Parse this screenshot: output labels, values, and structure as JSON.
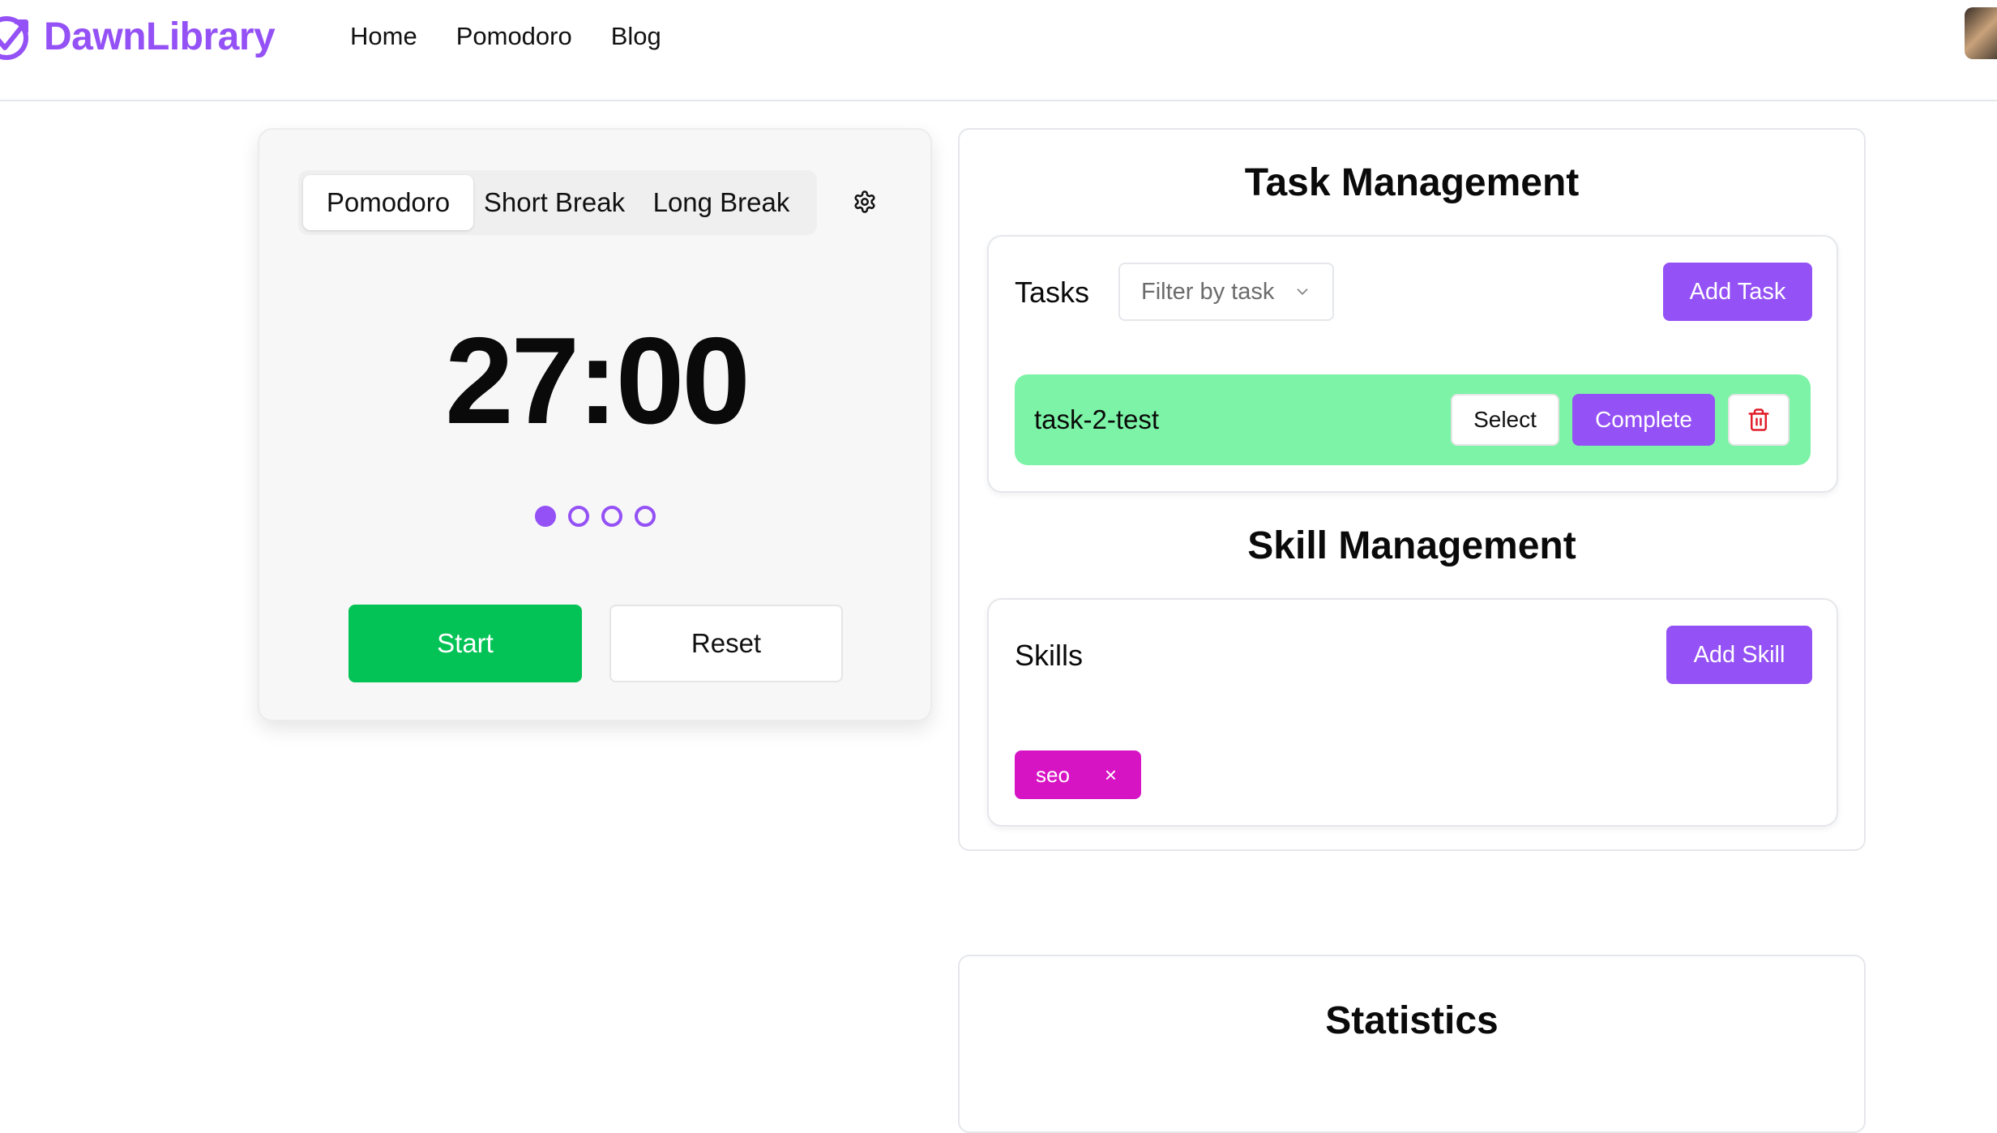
{
  "header": {
    "brand": "DawnLibrary",
    "nav": [
      {
        "label": "Home"
      },
      {
        "label": "Pomodoro"
      },
      {
        "label": "Blog"
      }
    ]
  },
  "timer": {
    "tabs": [
      {
        "label": "Pomodoro",
        "active": true
      },
      {
        "label": "Short Break",
        "active": false
      },
      {
        "label": "Long Break",
        "active": false
      }
    ],
    "time": "27:00",
    "sessions_completed": 1,
    "sessions_total": 4,
    "start_label": "Start",
    "reset_label": "Reset"
  },
  "task_management": {
    "title": "Task Management",
    "tasks_label": "Tasks",
    "filter_placeholder": "Filter by task",
    "add_label": "Add Task",
    "tasks": [
      {
        "name": "task-2-test",
        "select_label": "Select",
        "complete_label": "Complete"
      }
    ]
  },
  "skill_management": {
    "title": "Skill Management",
    "skills_label": "Skills",
    "add_label": "Add Skill",
    "skills": [
      {
        "name": "seo",
        "remove_symbol": "×"
      }
    ]
  },
  "statistics": {
    "title": "Statistics"
  },
  "colors": {
    "brand": "#9451f5",
    "start_button": "#04c356",
    "task_row": "#7cf3a6",
    "skill_tag": "#d714c4",
    "delete_icon": "#e11d2a"
  },
  "icons": {
    "logo": "clock-arrow-icon",
    "settings": "gear-icon",
    "filter": "chevron-down-icon",
    "delete": "trash-icon"
  }
}
